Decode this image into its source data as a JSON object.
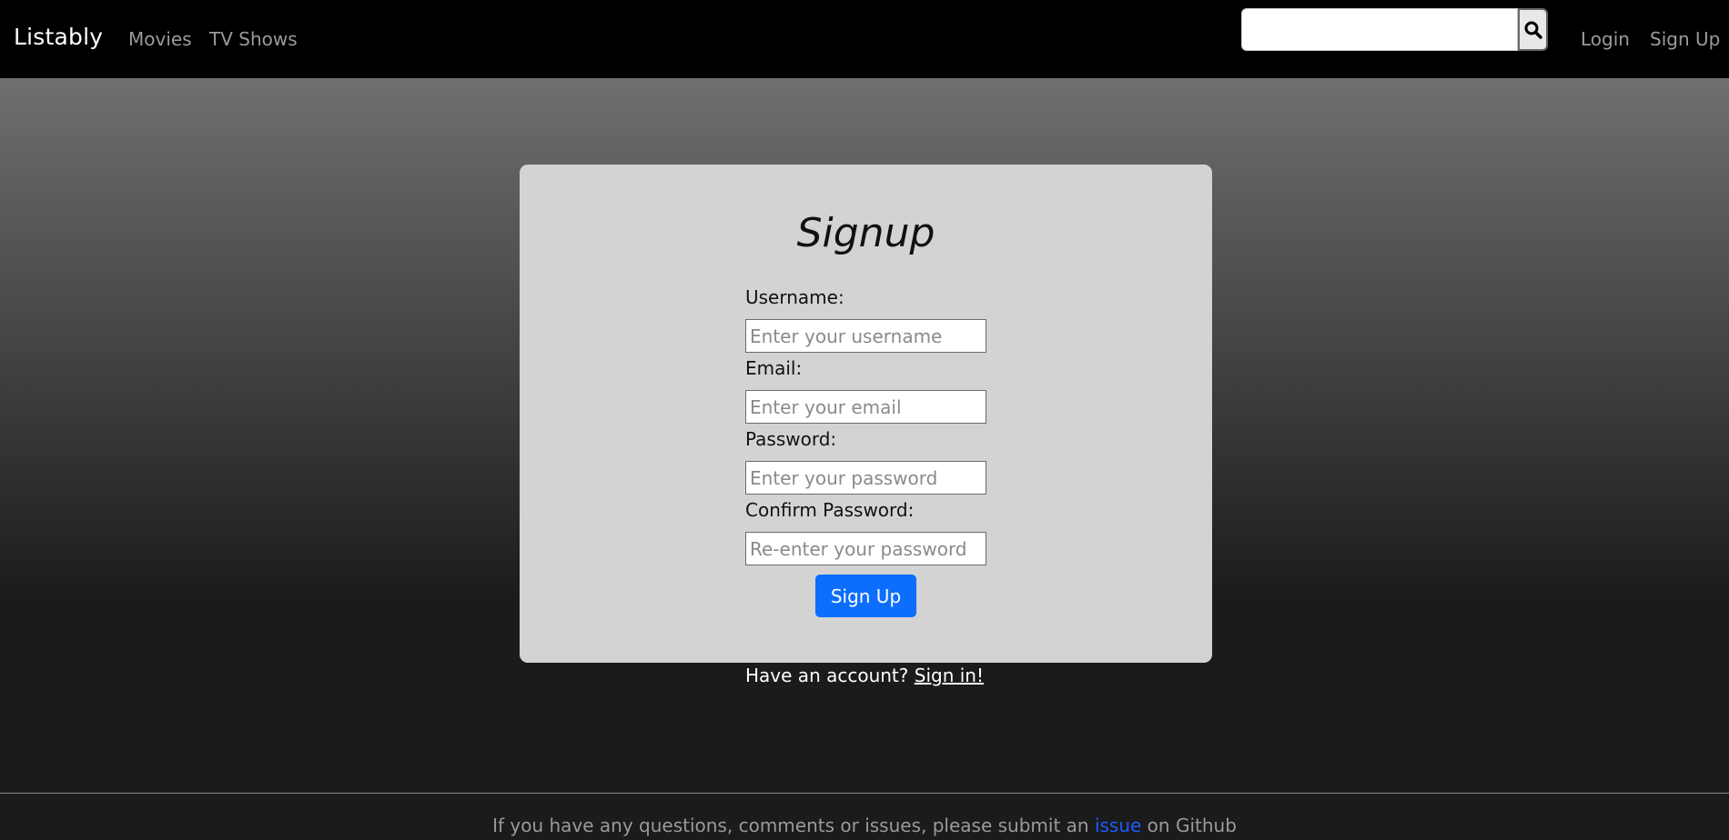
{
  "navbar": {
    "brand": "Listably",
    "links": [
      "Movies",
      "TV Shows"
    ],
    "search": {
      "placeholder": "",
      "button_icon": "search-icon"
    },
    "right_links": [
      "Login",
      "Sign Up"
    ]
  },
  "form": {
    "title": "Signup",
    "fields": [
      {
        "label": "Username:",
        "placeholder": "Enter your username"
      },
      {
        "label": "Email:",
        "placeholder": "Enter your email"
      },
      {
        "label": "Password:",
        "placeholder": "Enter your password"
      },
      {
        "label": "Confirm Password:",
        "placeholder": "Re-enter your password"
      }
    ],
    "submit_label": "Sign Up"
  },
  "account_prompt": {
    "text": "Have an account? ",
    "link": "Sign in!"
  },
  "footer": {
    "before": "If you have any questions, comments or issues, please submit an ",
    "link": "issue",
    "after": " on Github"
  },
  "colors": {
    "primary": "#0d6efd",
    "footer_link": "#1a5cff"
  }
}
